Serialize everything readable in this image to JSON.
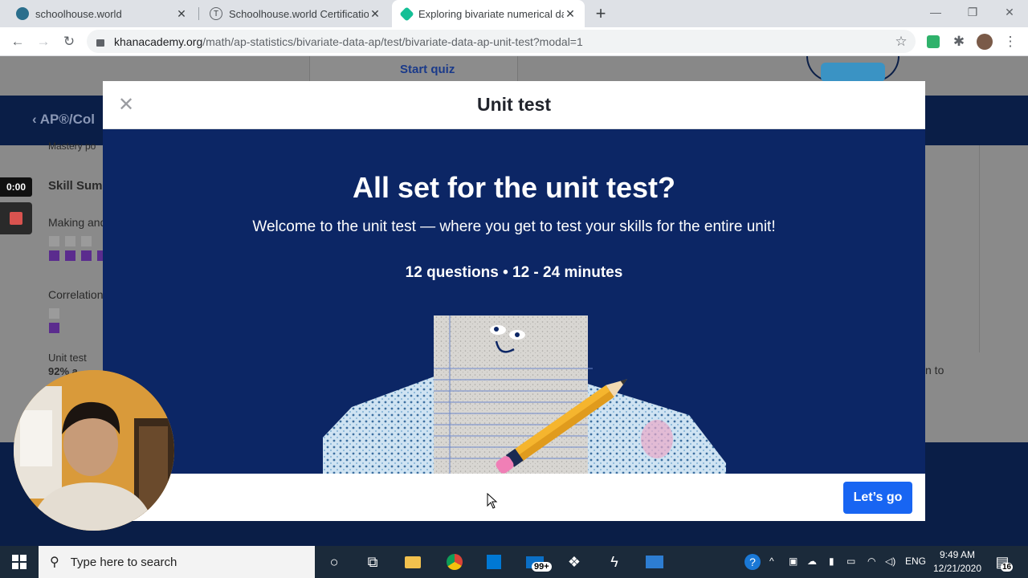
{
  "browser": {
    "tabs": [
      {
        "label": "schoolhouse.world",
        "active": false
      },
      {
        "label": "Schoolhouse.world Certification S",
        "active": false
      },
      {
        "label": "Exploring bivariate numerical dat",
        "active": true
      }
    ],
    "url_host": "khanacademy.org",
    "url_path": "/math/ap-statistics/bivariate-data-ap/test/bivariate-data-ap-unit-test?modal=1"
  },
  "background_page": {
    "start_quiz": "Start quiz",
    "course_title": "AP®/Col",
    "mastery": "Mastery po",
    "skill_summary": "Skill Summ",
    "skill_1": "Making and",
    "skill_2": "Correlation",
    "unit_test": "Unit test",
    "unit_test_score": "92% a",
    "right_fragment": "n to"
  },
  "modal": {
    "title": "Unit test",
    "headline": "All set for the unit test?",
    "subtext": "Welcome to the unit test — where you get to test your skills for the entire unit!",
    "meta": "12 questions • 12 - 24 minutes",
    "cta": "Let’s go"
  },
  "recorder": {
    "timer": "0:00"
  },
  "taskbar": {
    "search_placeholder": "Type here to search",
    "mail_badge": "99+",
    "language": "ENG",
    "time": "9:49 AM",
    "date": "12/21/2020",
    "notification_count": "16"
  },
  "colors": {
    "modal_body": "#0c2665",
    "cta": "#1865f2",
    "page_dark": "#0a1e47"
  }
}
